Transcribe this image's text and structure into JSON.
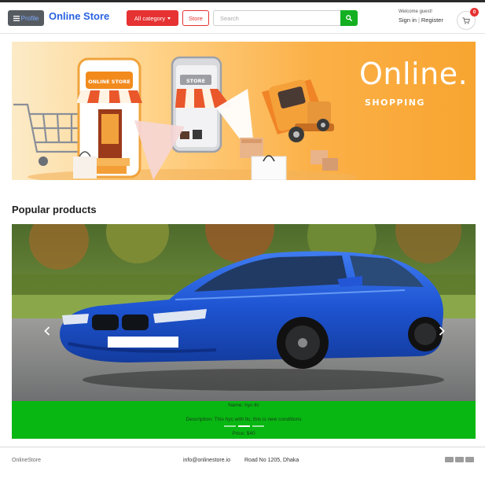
{
  "header": {
    "profile_label": "Profile",
    "menu_icon": "hamburger-icon",
    "brand": "Online Store",
    "all_category_label": "All category",
    "store_label": "Store",
    "search": {
      "placeholder": "Search",
      "value": ""
    },
    "search_icon": "search-icon",
    "welcome": "Welcome guest!",
    "sign_in": "Sign in",
    "separator": "|",
    "register": "Register",
    "cart_icon": "cart-icon",
    "cart_count": "0"
  },
  "banner": {
    "title": "Online.",
    "subtitle": "SHOPPING",
    "shop_sign": "ONLINE STORE",
    "phone_sign": "STORE"
  },
  "popular": {
    "title": "Popular products",
    "slide": {
      "name": "Name: hyc-tlc",
      "description": "Description: This hyc with tlc, this is new conditions",
      "price": "Price: $40"
    },
    "indicator_count": 3,
    "active_indicator": 1
  },
  "footer": {
    "brand": "OnlineStore",
    "email": "info@onlinestore.io",
    "address": "Road No 1205, Dhaka",
    "payment_icons": [
      "visa-card-icon",
      "mastercard-icon",
      "paypal-icon"
    ]
  },
  "colors": {
    "brand_blue": "#2a63e0",
    "accent_red": "#e63232",
    "search_green": "#14b021",
    "caption_green": "#08b712",
    "banner_orange": "#f8a531"
  }
}
